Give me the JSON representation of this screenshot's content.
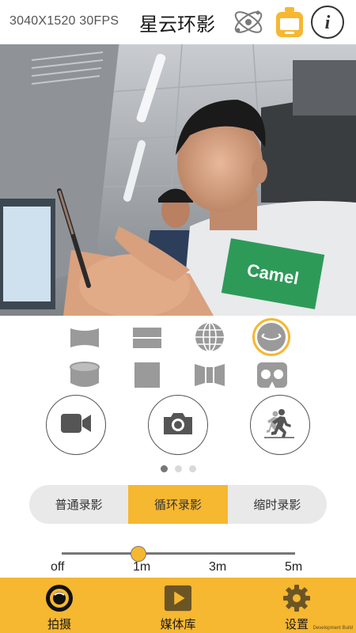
{
  "header": {
    "resolution": "3040X1520 30FPS",
    "title": "星云环影",
    "icons": [
      "orbit-icon",
      "camera-device-icon",
      "info-icon"
    ]
  },
  "preview": {
    "content": "camera-live-preview",
    "shirt_text": "Camel"
  },
  "projection_modes": {
    "row1": [
      "wide-angle-icon",
      "split-view-icon",
      "globe-icon",
      "fisheye-icon"
    ],
    "row2": [
      "cylinder-icon",
      "square-icon",
      "panorama-curved-icon",
      "vr-goggles-icon"
    ],
    "selected": "fisheye-icon"
  },
  "actions": [
    "video-camera-icon",
    "photo-camera-icon",
    "motion-runner-icon"
  ],
  "pager": {
    "count": 3,
    "active": 1
  },
  "record_modes": {
    "options": [
      "普通录影",
      "循环录影",
      "缩时录影"
    ],
    "selected": "循环录影"
  },
  "loop_slider": {
    "ticks": [
      "off",
      "1m",
      "3m",
      "5m"
    ],
    "value": "1m"
  },
  "bottom_nav": {
    "items": [
      {
        "label": "拍摄",
        "icon": "shoot-lens-icon"
      },
      {
        "label": "媒体库",
        "icon": "media-play-icon"
      },
      {
        "label": "设置",
        "icon": "gear-icon"
      }
    ]
  },
  "watermark": "Development Build",
  "colors": {
    "accent": "#f6b731",
    "icon_gray": "#9a9a9a",
    "dark_icon": "#555555"
  }
}
